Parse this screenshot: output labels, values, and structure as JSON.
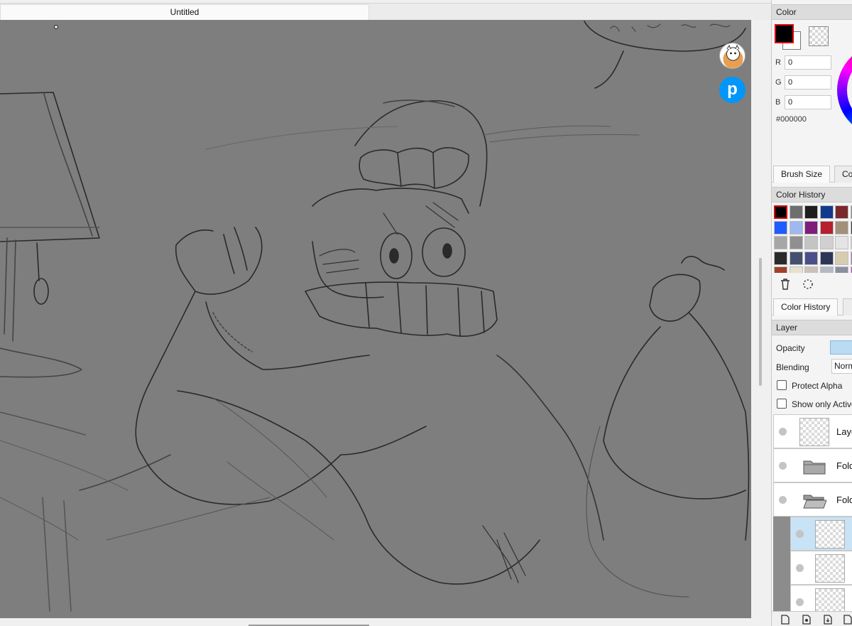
{
  "document": {
    "tab_title": "Untitled"
  },
  "overlay": {
    "pixiv_letter": "p"
  },
  "color_panel": {
    "header": "Color",
    "fg_color": "#000000",
    "bg_color": "#ffffff",
    "r_label": "R",
    "r_value": "0",
    "g_label": "G",
    "g_value": "0",
    "b_label": "B",
    "b_value": "0",
    "hex": "#000000"
  },
  "tool_tabs": {
    "brush_size": "Brush Size",
    "second_tab": "Co"
  },
  "color_history": {
    "header": "Color History",
    "swatches": [
      "#000000",
      "#6e6e6e",
      "#1e1e1e",
      "#123a8c",
      "#7a2a2a",
      "#888888",
      "#1f5bff",
      "#9fb8f0",
      "#7b1f7a",
      "#b51f2e",
      "#a3907a",
      "#3a3a3a",
      "#a6a6a6",
      "#8f8f8f",
      "#c4c4c4",
      "#d0d0d0",
      "#e4e4e4",
      "#cfcfcf",
      "#2a2a2a",
      "#44506e",
      "#4a4f8c",
      "#2e3657",
      "#d8ccb0",
      "#9a7fa0",
      "#a0402a",
      "#e8e0d0",
      "#c9c2b8",
      "#b4b9c6",
      "#8a8fa0",
      "#c04ad8"
    ],
    "delete_icon": "trash-icon",
    "extra_icon": "dotted-circle-icon",
    "tab_label": "Color History"
  },
  "layer_panel": {
    "header": "Layer",
    "opacity_label": "Opacity",
    "blending_label": "Blending",
    "blending_value": "Normal",
    "protect_alpha": "Protect Alpha",
    "show_only_active": "Show only Active",
    "layers": [
      {
        "name": "Layer",
        "kind": "layer"
      },
      {
        "name": "Folder",
        "kind": "folder-closed"
      },
      {
        "name": "Folder",
        "kind": "folder-open"
      }
    ]
  }
}
